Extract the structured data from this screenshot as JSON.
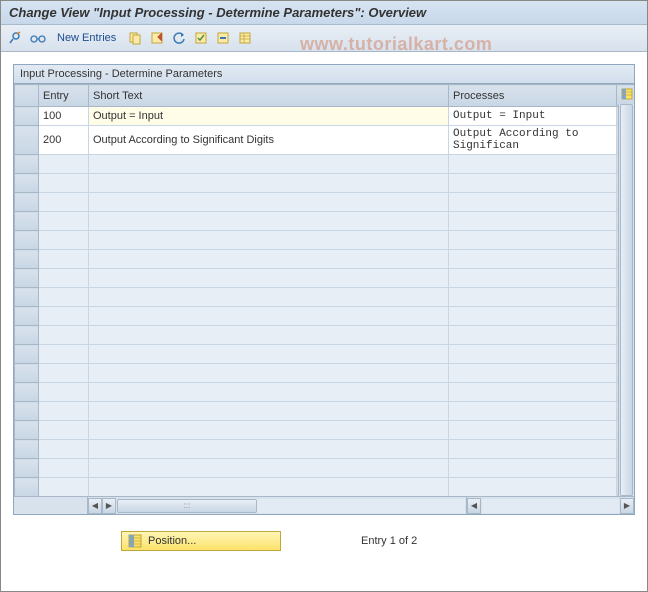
{
  "title": "Change View \"Input Processing - Determine Parameters\": Overview",
  "watermark": "www.tutorialkart.com",
  "toolbar": {
    "new_entries_label": "New Entries"
  },
  "panel": {
    "header": "Input Processing - Determine Parameters",
    "columns": {
      "entry": "Entry",
      "short_text": "Short Text",
      "processes": "Processes"
    },
    "rows": [
      {
        "entry": "100",
        "short_text": "Output = Input",
        "processes": "Output = Input"
      },
      {
        "entry": "200",
        "short_text": "Output According to Significant Digits",
        "processes": "Output According to Significan"
      }
    ]
  },
  "footer": {
    "position_label": "Position...",
    "status_text": "Entry 1 of 2"
  }
}
